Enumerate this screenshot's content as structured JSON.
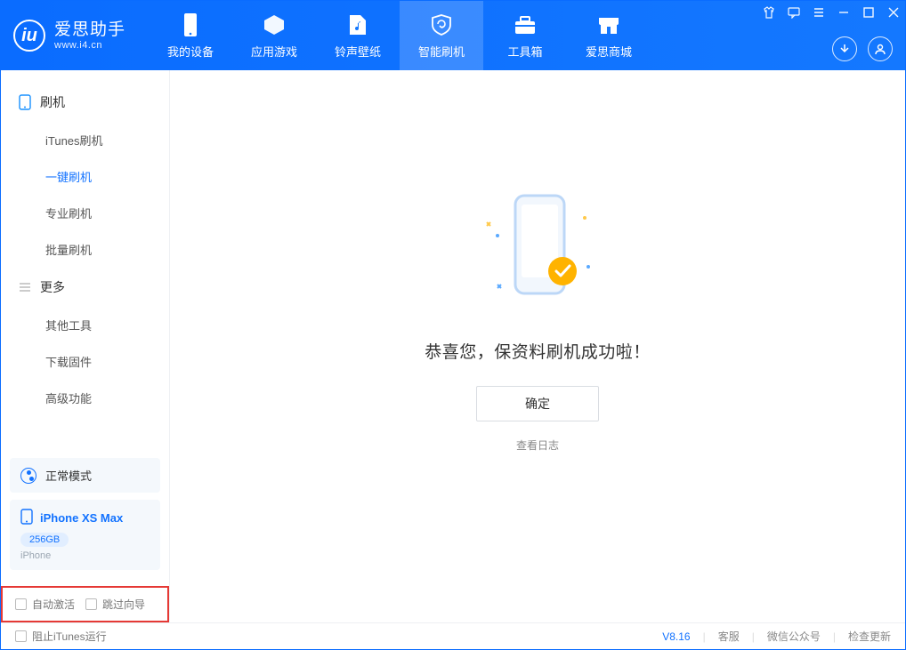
{
  "app": {
    "title": "爱思助手",
    "url": "www.i4.cn"
  },
  "tabs": [
    "我的设备",
    "应用游戏",
    "铃声壁纸",
    "智能刷机",
    "工具箱",
    "爱思商城"
  ],
  "active_tab_index": 3,
  "sidebar": {
    "flash_group": "刷机",
    "flash_items": [
      "iTunes刷机",
      "一键刷机",
      "专业刷机",
      "批量刷机"
    ],
    "active_flash_index": 1,
    "more_group": "更多",
    "more_items": [
      "其他工具",
      "下载固件",
      "高级功能"
    ]
  },
  "mode_card": {
    "label": "正常模式"
  },
  "device_card": {
    "name": "iPhone XS Max",
    "storage": "256GB",
    "type": "iPhone"
  },
  "options": {
    "auto_activate": "自动激活",
    "skip_guide": "跳过向导"
  },
  "main": {
    "success_text": "恭喜您，保资料刷机成功啦！",
    "ok": "确定",
    "view_log": "查看日志"
  },
  "status": {
    "block_itunes": "阻止iTunes运行",
    "version": "V8.16",
    "service": "客服",
    "wechat": "微信公众号",
    "check_update": "检查更新"
  }
}
